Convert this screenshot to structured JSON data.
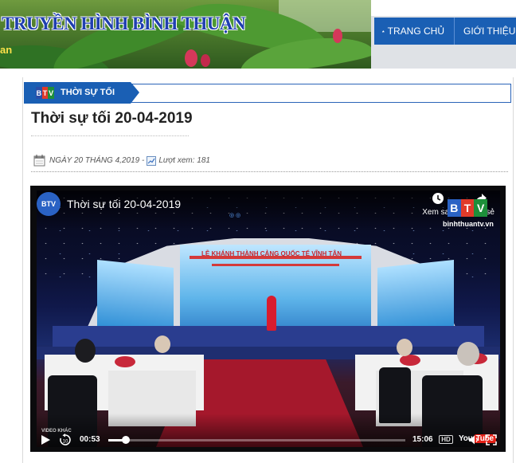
{
  "header": {
    "site_title": "TRUYỀN HÌNH BÌNH THUẬN",
    "site_subtitle": "an"
  },
  "nav": {
    "home": "TRANG CHỦ",
    "about": "GIỚI THIỆU"
  },
  "category": {
    "logo": [
      "B",
      "T",
      "V"
    ],
    "label": "THỜI SỰ TỐI"
  },
  "article": {
    "title": "Thời sự tối 20-04-2019",
    "date": "NGÀY 20 THÁNG 4,2019 -",
    "views_label": "Lượt xem: 181"
  },
  "video": {
    "channel_logo": "BTV",
    "title": "Thời sự tối 20-04-2019",
    "watch_later": "Xem sau",
    "share": "Chia sẻ",
    "watermark_logo": [
      "B",
      "T",
      "V"
    ],
    "watermark_url": "binhthuantv.vn",
    "stage_text": "LỄ KHÁNH THÀNH CẢNG QUỐC TẾ VĨNH TÂN",
    "current_time": "00:53",
    "duration": "15:06",
    "progress": 0.06,
    "hd": "HD",
    "youtube_label": "You",
    "youtube_box": "Tube",
    "chip_text": "VIDEO KHÁC"
  },
  "colors": {
    "nav_blue": "#1a5fb4",
    "title_blue": "#1f3fb0",
    "youtube_red": "#e62117"
  }
}
